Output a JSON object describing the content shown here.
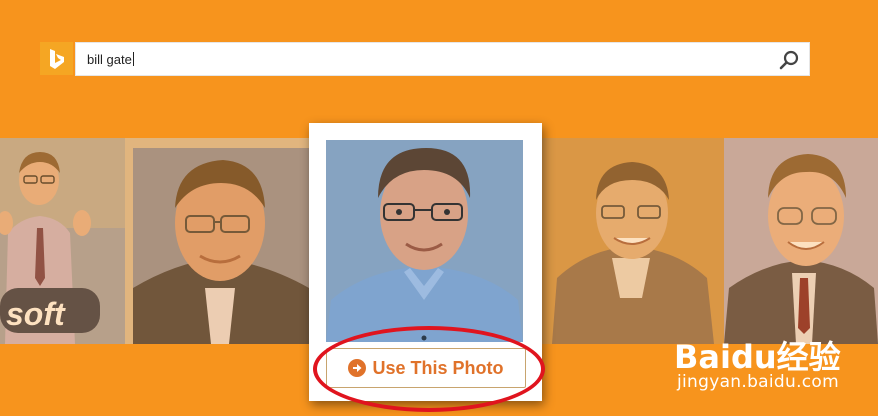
{
  "search": {
    "query": "bill gate",
    "logo": "bing-logo-icon",
    "search_icon": "search-icon"
  },
  "strip": {
    "thumbnails": [
      {
        "name": "thumbnail-1",
        "text": "soft"
      },
      {
        "name": "thumbnail-2"
      },
      {
        "name": "thumbnail-4"
      },
      {
        "name": "thumbnail-5"
      }
    ]
  },
  "selected": {
    "button_label": "Use This Photo",
    "button_icon": "arrow-right-circle-icon"
  },
  "watermark": {
    "brand": "Baidu经验",
    "url": "jingyan.baidu.com"
  },
  "colors": {
    "background": "#f7941d",
    "accent": "#e0722a",
    "highlight": "#e0141e",
    "logo": "#f5a623"
  }
}
